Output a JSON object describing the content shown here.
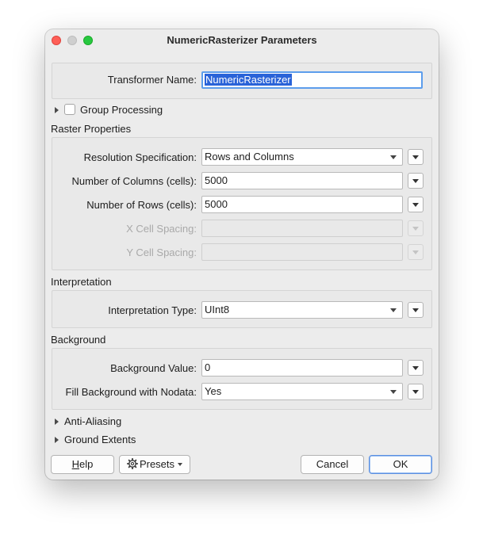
{
  "window": {
    "title": "NumericRasterizer Parameters"
  },
  "transformer": {
    "name_label": "Transformer Name:",
    "name_value": "NumericRasterizer"
  },
  "group_processing": {
    "label": "Group Processing",
    "checked": false
  },
  "raster_properties": {
    "section_title": "Raster Properties",
    "resolution_label": "Resolution Specification:",
    "resolution_value": "Rows and Columns",
    "columns_label": "Number of Columns (cells):",
    "columns_value": "5000",
    "rows_label": "Number of Rows (cells):",
    "rows_value": "5000",
    "x_spacing_label": "X Cell Spacing:",
    "x_spacing_value": "",
    "y_spacing_label": "Y Cell Spacing:",
    "y_spacing_value": ""
  },
  "interpretation": {
    "section_title": "Interpretation",
    "type_label": "Interpretation Type:",
    "type_value": "UInt8"
  },
  "background": {
    "section_title": "Background",
    "value_label": "Background Value:",
    "value_value": "0",
    "nodata_label": "Fill Background with Nodata:",
    "nodata_value": "Yes"
  },
  "collapsed_sections": {
    "anti_aliasing": "Anti-Aliasing",
    "ground_extents": "Ground Extents"
  },
  "buttons": {
    "help_mnemonic": "H",
    "help_rest": "elp",
    "presets": "Presets",
    "cancel": "Cancel",
    "ok": "OK"
  },
  "icons": {
    "gear": "gear-icon",
    "dropdown": "chevron-down-icon",
    "expander": "disclosure-triangle-icon"
  },
  "colors": {
    "close": "#fe5f57",
    "maximize": "#28c840",
    "selection": "#2a63d8",
    "focus_ring": "#5c9dec"
  }
}
